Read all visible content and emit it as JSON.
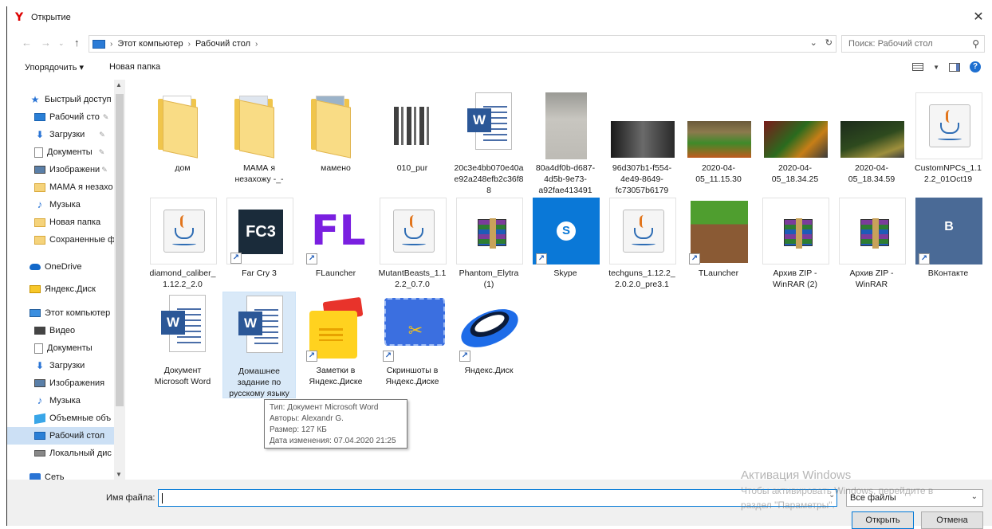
{
  "window": {
    "title": "Открытие",
    "close_glyph": "✕"
  },
  "address": {
    "crumbs": [
      "Этот компьютер",
      "Рабочий стол"
    ],
    "search_placeholder": "Поиск: Рабочий стол"
  },
  "toolbar": {
    "organize": "Упорядочить ▾",
    "new_folder": "Новая папка"
  },
  "sidebar": {
    "items": [
      {
        "label": "Быстрый доступ",
        "icon": "star-icon",
        "pinned": false
      },
      {
        "label": "Рабочий сто",
        "icon": "desktop-icon",
        "pinned": true
      },
      {
        "label": "Загрузки",
        "icon": "downloads-icon",
        "pinned": true
      },
      {
        "label": "Документы",
        "icon": "documents-icon",
        "pinned": true
      },
      {
        "label": "Изображени",
        "icon": "pictures-icon",
        "pinned": true
      },
      {
        "label": "МАМА я незахо",
        "icon": "folder-icon",
        "pinned": false
      },
      {
        "label": "Музыка",
        "icon": "music-icon",
        "pinned": false
      },
      {
        "label": "Новая папка",
        "icon": "folder-icon",
        "pinned": false
      },
      {
        "label": "Сохраненные ф",
        "icon": "folder-icon",
        "pinned": false
      },
      {
        "label": "OneDrive",
        "icon": "onedrive-icon",
        "pinned": false
      },
      {
        "label": "Яндекс.Диск",
        "icon": "yandex-disk-icon",
        "pinned": false
      },
      {
        "label": "Этот компьютер",
        "icon": "computer-icon",
        "pinned": false
      },
      {
        "label": "Видео",
        "icon": "video-icon",
        "pinned": false
      },
      {
        "label": "Документы",
        "icon": "documents-icon",
        "pinned": false
      },
      {
        "label": "Загрузки",
        "icon": "downloads-icon",
        "pinned": false
      },
      {
        "label": "Изображения",
        "icon": "pictures-icon",
        "pinned": false
      },
      {
        "label": "Музыка",
        "icon": "music-icon",
        "pinned": false
      },
      {
        "label": "Объемные объ",
        "icon": "3d-objects-icon",
        "pinned": false
      },
      {
        "label": "Рабочий стол",
        "icon": "desktop-icon",
        "pinned": false,
        "selected": true
      },
      {
        "label": "Локальный дис",
        "icon": "drive-icon",
        "pinned": false
      },
      {
        "label": "Сеть",
        "icon": "network-icon",
        "pinned": false
      }
    ]
  },
  "files": [
    {
      "name": "дом",
      "type": "folder"
    },
    {
      "name": "МАМА я незахожу -_-",
      "type": "folder"
    },
    {
      "name": "мамено",
      "type": "folder"
    },
    {
      "name": "010_pur",
      "type": "image-doc"
    },
    {
      "name": "20c3e4bb070e40ae92a248efb2c36f88",
      "type": "word"
    },
    {
      "name": "80a4df0b-d687-4d5b-9e73-a92fae413491",
      "type": "photo-gray"
    },
    {
      "name": "96d307b1-f554-4e49-8649-fc73057b6179",
      "type": "photo-dark"
    },
    {
      "name": "2020-04-05_11.15.30",
      "type": "game-shot-1"
    },
    {
      "name": "2020-04-05_18.34.25",
      "type": "game-shot-2"
    },
    {
      "name": "2020-04-05_18.34.59",
      "type": "game-shot-3"
    },
    {
      "name": "CustomNPCs_1.12.2_01Oct19",
      "type": "java"
    },
    {
      "name": "diamond_caliber_1.12.2_2.0",
      "type": "java"
    },
    {
      "name": "Far Cry 3",
      "type": "farcry",
      "shortcut": true,
      "logo_text": "FC3"
    },
    {
      "name": "FLauncher",
      "type": "flauncher",
      "shortcut": true,
      "logo_text": "FL"
    },
    {
      "name": "MutantBeasts_1.12.2_0.7.0",
      "type": "java"
    },
    {
      "name": "Phantom_Elytra (1)",
      "type": "winrar"
    },
    {
      "name": "Skype",
      "type": "skype",
      "shortcut": true,
      "logo_text": "S"
    },
    {
      "name": "techguns_1.12.2_2.0.2.0_pre3.1",
      "type": "java"
    },
    {
      "name": "TLauncher",
      "type": "tlauncher",
      "shortcut": true
    },
    {
      "name": "Архив ZIP - WinRAR (2)",
      "type": "winrar"
    },
    {
      "name": "Архив ZIP - WinRAR",
      "type": "winrar"
    },
    {
      "name": "ВКонтакте",
      "type": "vk",
      "shortcut": true,
      "logo_text": "B"
    },
    {
      "name": "Документ Microsoft Word",
      "type": "word"
    },
    {
      "name": "Домашнее задание по русскому языку",
      "type": "word",
      "selected": true
    },
    {
      "name": "Заметки в Яндекс.Диске",
      "type": "ynotes",
      "shortcut": true
    },
    {
      "name": "Скриншоты в Яндекс.Диске",
      "type": "yscreens",
      "shortcut": true
    },
    {
      "name": "Яндекс.Диск",
      "type": "ydisk",
      "shortcut": true
    }
  ],
  "tooltip": {
    "type": "Тип: Документ Microsoft Word",
    "authors": "Авторы: Alexandr G.",
    "size": "Размер: 127 КБ",
    "modified": "Дата изменения: 07.04.2020 21:25"
  },
  "watermark": {
    "line1": "Активация Windows",
    "line2": "Чтобы активировать Windows, перейдите в",
    "line3": "раздел \"Параметры\"."
  },
  "footer": {
    "filename_label": "Имя файла:",
    "filename_value": "",
    "filter": "Все файлы",
    "open": "Открыть",
    "cancel": "Отмена"
  }
}
